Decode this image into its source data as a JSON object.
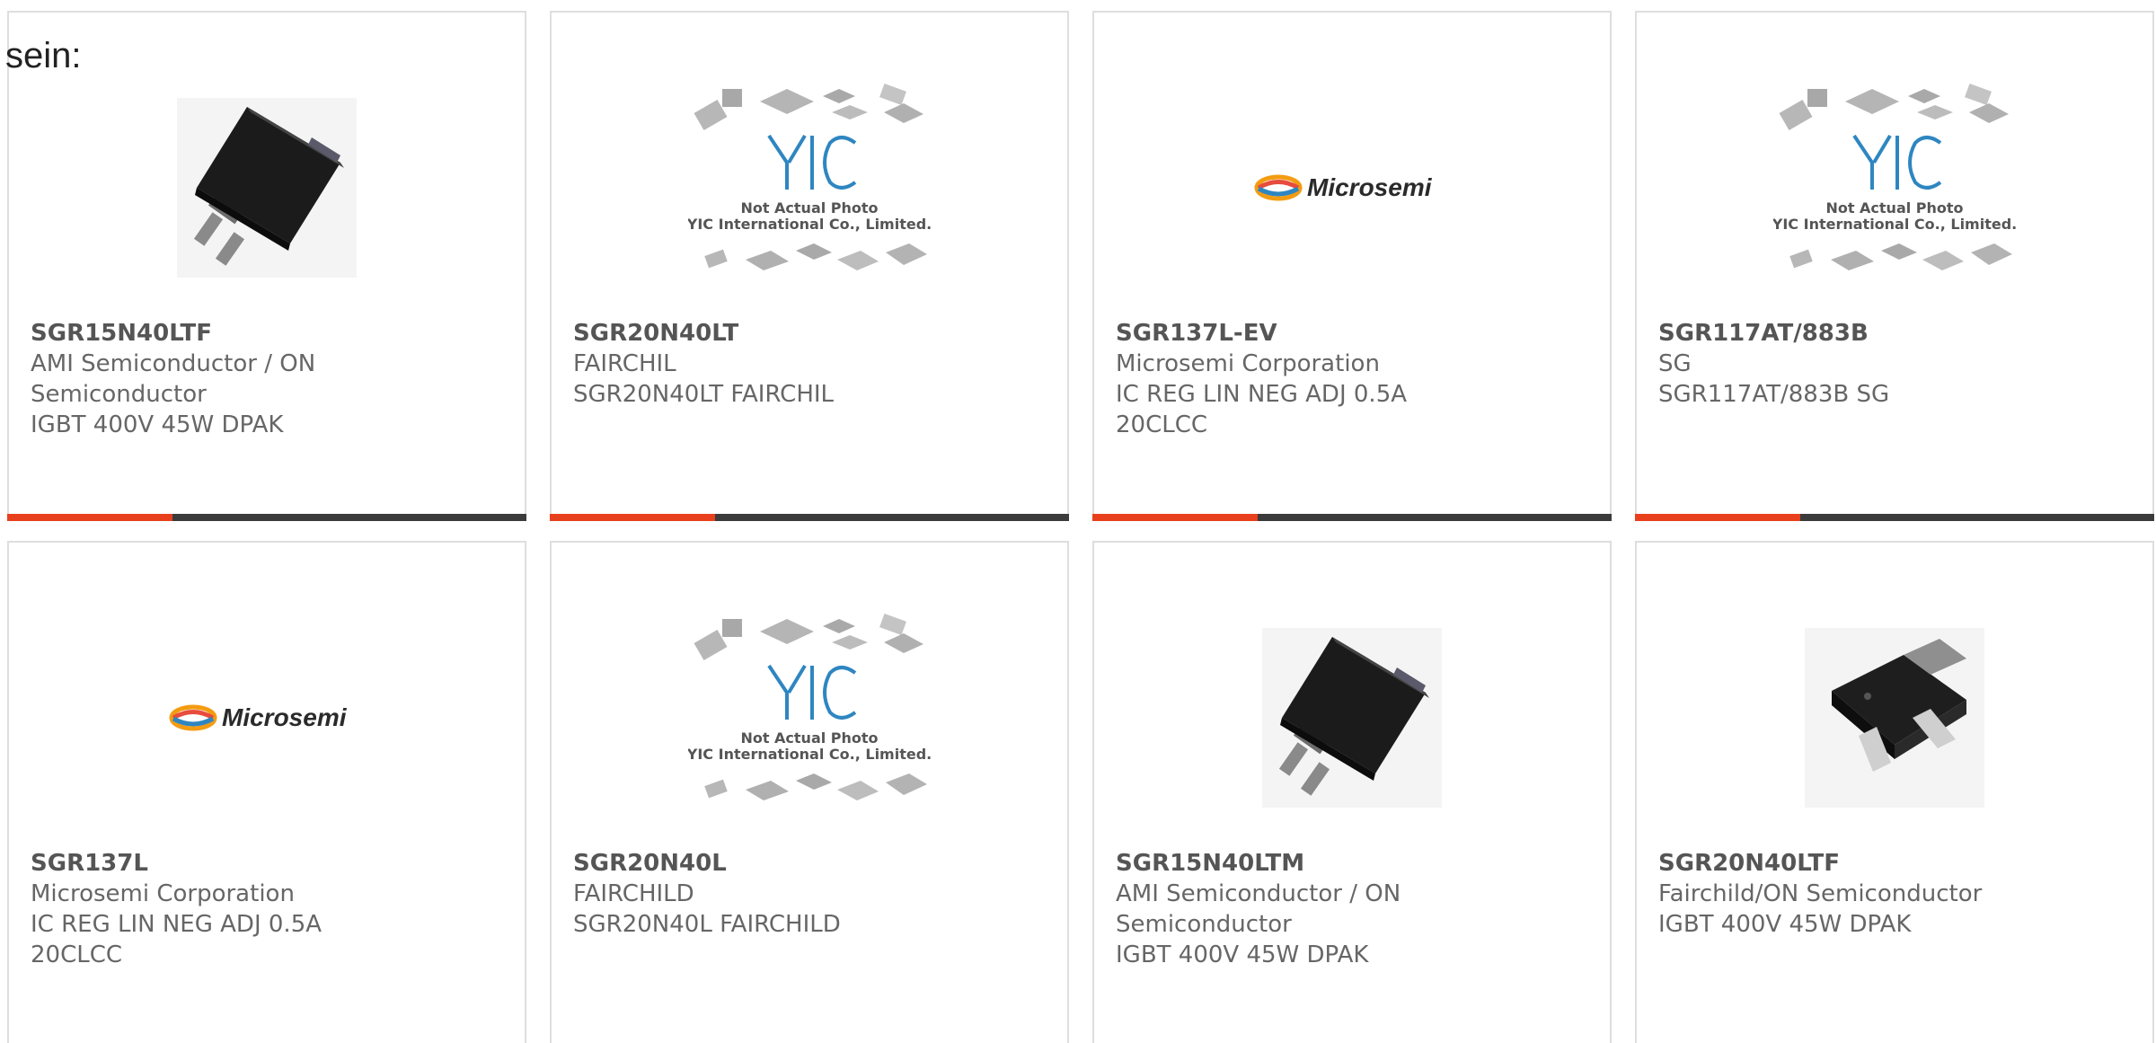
{
  "intro_text": "sein:",
  "yic": {
    "logo_text": "YIC",
    "caption_line1": "Not Actual Photo",
    "caption_line2": "YIC International Co., Limited."
  },
  "microsemi": {
    "logo_text": "Microsemi"
  },
  "colors": {
    "accent": "#e8401c",
    "bar": "#3b3b3b",
    "border": "#dedede",
    "text": "#666666"
  },
  "products": [
    {
      "part_number": "SGR15N40LTF",
      "manufacturer": "AMI Semiconductor / ON Semiconductor",
      "description": "IGBT 400V 45W DPAK",
      "image": "dpak-chip-icon"
    },
    {
      "part_number": "SGR20N40LT",
      "manufacturer": "FAIRCHIL",
      "description": "SGR20N40LT FAIRCHIL",
      "image": "yic-placeholder-icon"
    },
    {
      "part_number": "SGR137L-EV",
      "manufacturer": "Microsemi Corporation",
      "description": "IC REG LIN NEG ADJ 0.5A 20CLCC",
      "image": "microsemi-logo-icon"
    },
    {
      "part_number": "SGR117AT/883B",
      "manufacturer": "SG",
      "description": "SGR117AT/883B SG",
      "image": "yic-placeholder-icon"
    },
    {
      "part_number": "SGR137L",
      "manufacturer": "Microsemi Corporation",
      "description": "IC REG LIN NEG ADJ 0.5A 20CLCC",
      "image": "microsemi-logo-icon"
    },
    {
      "part_number": "SGR20N40L",
      "manufacturer": "FAIRCHILD",
      "description": "SGR20N40L FAIRCHILD",
      "image": "yic-placeholder-icon"
    },
    {
      "part_number": "SGR15N40LTM",
      "manufacturer": "AMI Semiconductor / ON Semiconductor",
      "description": "IGBT 400V 45W DPAK",
      "image": "dpak-chip-icon"
    },
    {
      "part_number": "SGR20N40LTF",
      "manufacturer": "Fairchild/ON Semiconductor",
      "description": "IGBT 400V 45W DPAK",
      "image": "dpak-chip-flat-icon"
    }
  ]
}
